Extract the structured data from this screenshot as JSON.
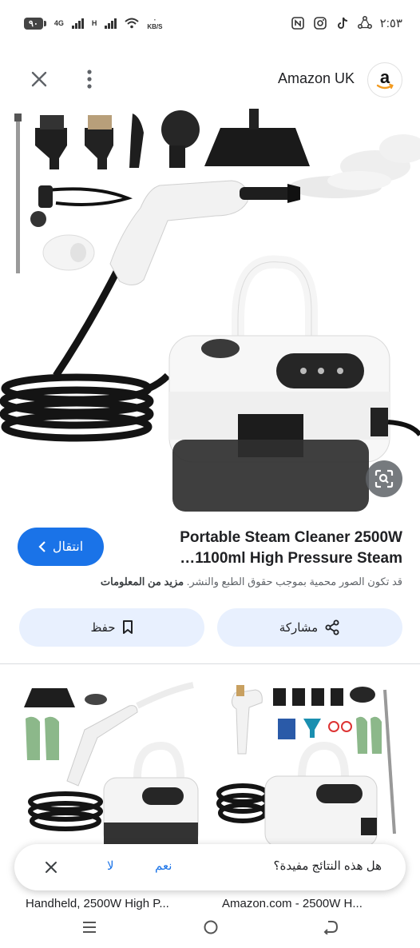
{
  "status_bar": {
    "battery": "٩٠",
    "net_type_1": "4G",
    "net_type_2": "H",
    "speed_value": "٠",
    "speed_unit": "KB/S",
    "time": "٢:٥٣",
    "icons": [
      "battery-icon",
      "signal-icon",
      "signal-icon",
      "wifi-icon",
      "nfc-icon",
      "instagram-icon",
      "tiktok-icon",
      "sync-icon"
    ]
  },
  "header": {
    "site_name": "Amazon UK",
    "logo_letter": "a"
  },
  "result": {
    "visit_label": "انتقال",
    "title_line_1": "Portable Steam Cleaner 2500W",
    "title_line_2": "…1100ml High Pressure Steam",
    "copyright_text": "قد تكون الصور محمية بموجب حقوق الطبع والنشر.",
    "more_info": "مزيد من المعلومات"
  },
  "actions": {
    "save_label": "حفظ",
    "share_label": "مشاركة"
  },
  "related": [
    {
      "caption": "Handheld, 2500W High P..."
    },
    {
      "caption": "Amazon.com - 2500W H..."
    }
  ],
  "feedback": {
    "question": "هل هذه النتائج مفيدة؟",
    "yes_label": "نعم",
    "no_label": "لا"
  },
  "colors": {
    "accent": "#1a73e8",
    "button_bg": "#e8f0fe"
  }
}
